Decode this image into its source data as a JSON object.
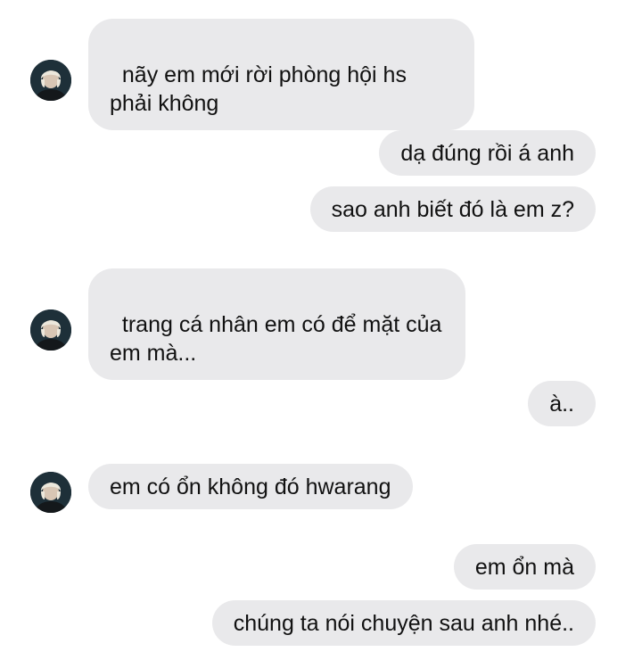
{
  "conversation": {
    "messages": [
      {
        "sender": "other",
        "text": "nãy em mới rời phòng hội hs phải không"
      },
      {
        "sender": "me",
        "text": "dạ đúng rồi á anh"
      },
      {
        "sender": "me",
        "text": "sao anh biết đó là em z?"
      },
      {
        "sender": "other",
        "text": "trang cá nhân em có để mặt của em mà..."
      },
      {
        "sender": "me",
        "text": "à.."
      },
      {
        "sender": "other",
        "text": "em có ổn không đó hwarang"
      },
      {
        "sender": "me",
        "text": "em ổn mà"
      },
      {
        "sender": "me",
        "text": "chúng ta nói chuyện sau anh nhé.."
      }
    ]
  },
  "colors": {
    "bubble_bg": "#e9e9eb",
    "text": "#111111",
    "avatar_bg": "#1e3039",
    "avatar_hair": "#e8e4d8"
  },
  "icons": {
    "avatar": "profile-photo-icon"
  }
}
